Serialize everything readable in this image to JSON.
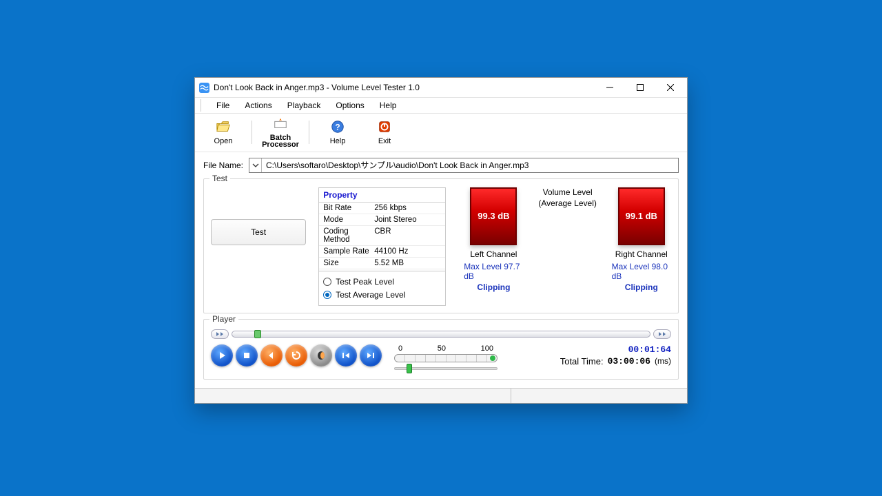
{
  "window": {
    "title": "Don't Look Back in Anger.mp3 - Volume Level Tester 1.0"
  },
  "menu": [
    "File",
    "Actions",
    "Playback",
    "Options",
    "Help"
  ],
  "toolbar": [
    {
      "id": "open",
      "label": "Open"
    },
    {
      "id": "batch",
      "label": "Batch\nProcessor"
    },
    {
      "id": "help",
      "label": "Help"
    },
    {
      "id": "exit",
      "label": "Exit"
    }
  ],
  "file": {
    "label": "File Name:",
    "path": "C:\\Users\\softaro\\Desktop\\サンプル\\audio\\Don't Look Back in Anger.mp3"
  },
  "test": {
    "legend": "Test",
    "button": "Test",
    "property_header": "Property",
    "properties": [
      {
        "k": "Bit Rate",
        "v": "256 kbps"
      },
      {
        "k": "Mode",
        "v": "Joint Stereo"
      },
      {
        "k": "Coding Method",
        "v": "CBR"
      },
      {
        "k": "Sample Rate",
        "v": "44100 Hz"
      },
      {
        "k": "Size",
        "v": "5.52 MB"
      }
    ],
    "radio_peak": "Test Peak Level",
    "radio_avg": "Test Average Level",
    "volume_title1": "Volume Level",
    "volume_title2": "(Average Level)",
    "left": {
      "value": "99.3 dB",
      "label": "Left Channel",
      "max": "Max Level 97.7 dB",
      "clip": "Clipping"
    },
    "right": {
      "value": "99.1 dB",
      "label": "Right Channel",
      "max": "Max Level 98.0 dB",
      "clip": "Clipping"
    }
  },
  "player": {
    "legend": "Player",
    "scale": {
      "t0": "0",
      "t50": "50",
      "t100": "100"
    },
    "current": "00:01:64",
    "total_label": "Total Time:",
    "total": "03:00:06",
    "unit": "(ms)"
  }
}
